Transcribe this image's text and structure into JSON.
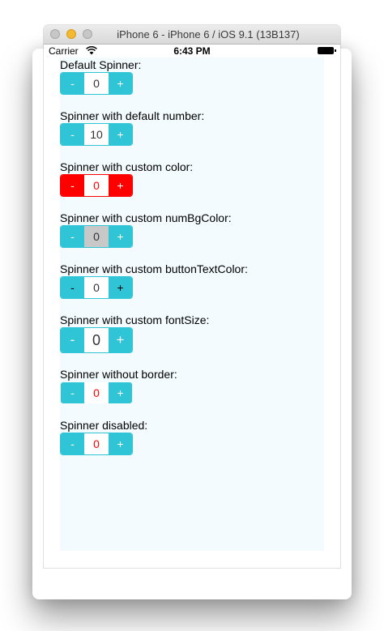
{
  "window": {
    "title": "iPhone 6 - iPhone 6 / iOS 9.1 (13B137)"
  },
  "statusbar": {
    "carrier": "Carrier",
    "time": "6:43 PM"
  },
  "colors": {
    "accent": "#2fc4d6",
    "custom_red": "#ff0000",
    "content_bg": "#f3fbff",
    "num_bg_custom": "#c8c8c8"
  },
  "spinners": [
    {
      "label": "Default Spinner:",
      "minus": "-",
      "value": "0",
      "plus": "+"
    },
    {
      "label": "Spinner with default number:",
      "minus": "-",
      "value": "10",
      "plus": "+"
    },
    {
      "label": "Spinner with custom color:",
      "minus": "-",
      "value": "0",
      "plus": "+"
    },
    {
      "label": "Spinner with custom numBgColor:",
      "minus": "-",
      "value": "0",
      "plus": "+"
    },
    {
      "label": "Spinner with custom buttonTextColor:",
      "minus": "-",
      "value": "0",
      "plus": "+"
    },
    {
      "label": "Spinner with custom fontSize:",
      "minus": "-",
      "value": "0",
      "plus": "+"
    },
    {
      "label": "Spinner without border:",
      "minus": "-",
      "value": "0",
      "plus": "+"
    },
    {
      "label": "Spinner disabled:",
      "minus": "-",
      "value": "0",
      "plus": "+"
    }
  ]
}
